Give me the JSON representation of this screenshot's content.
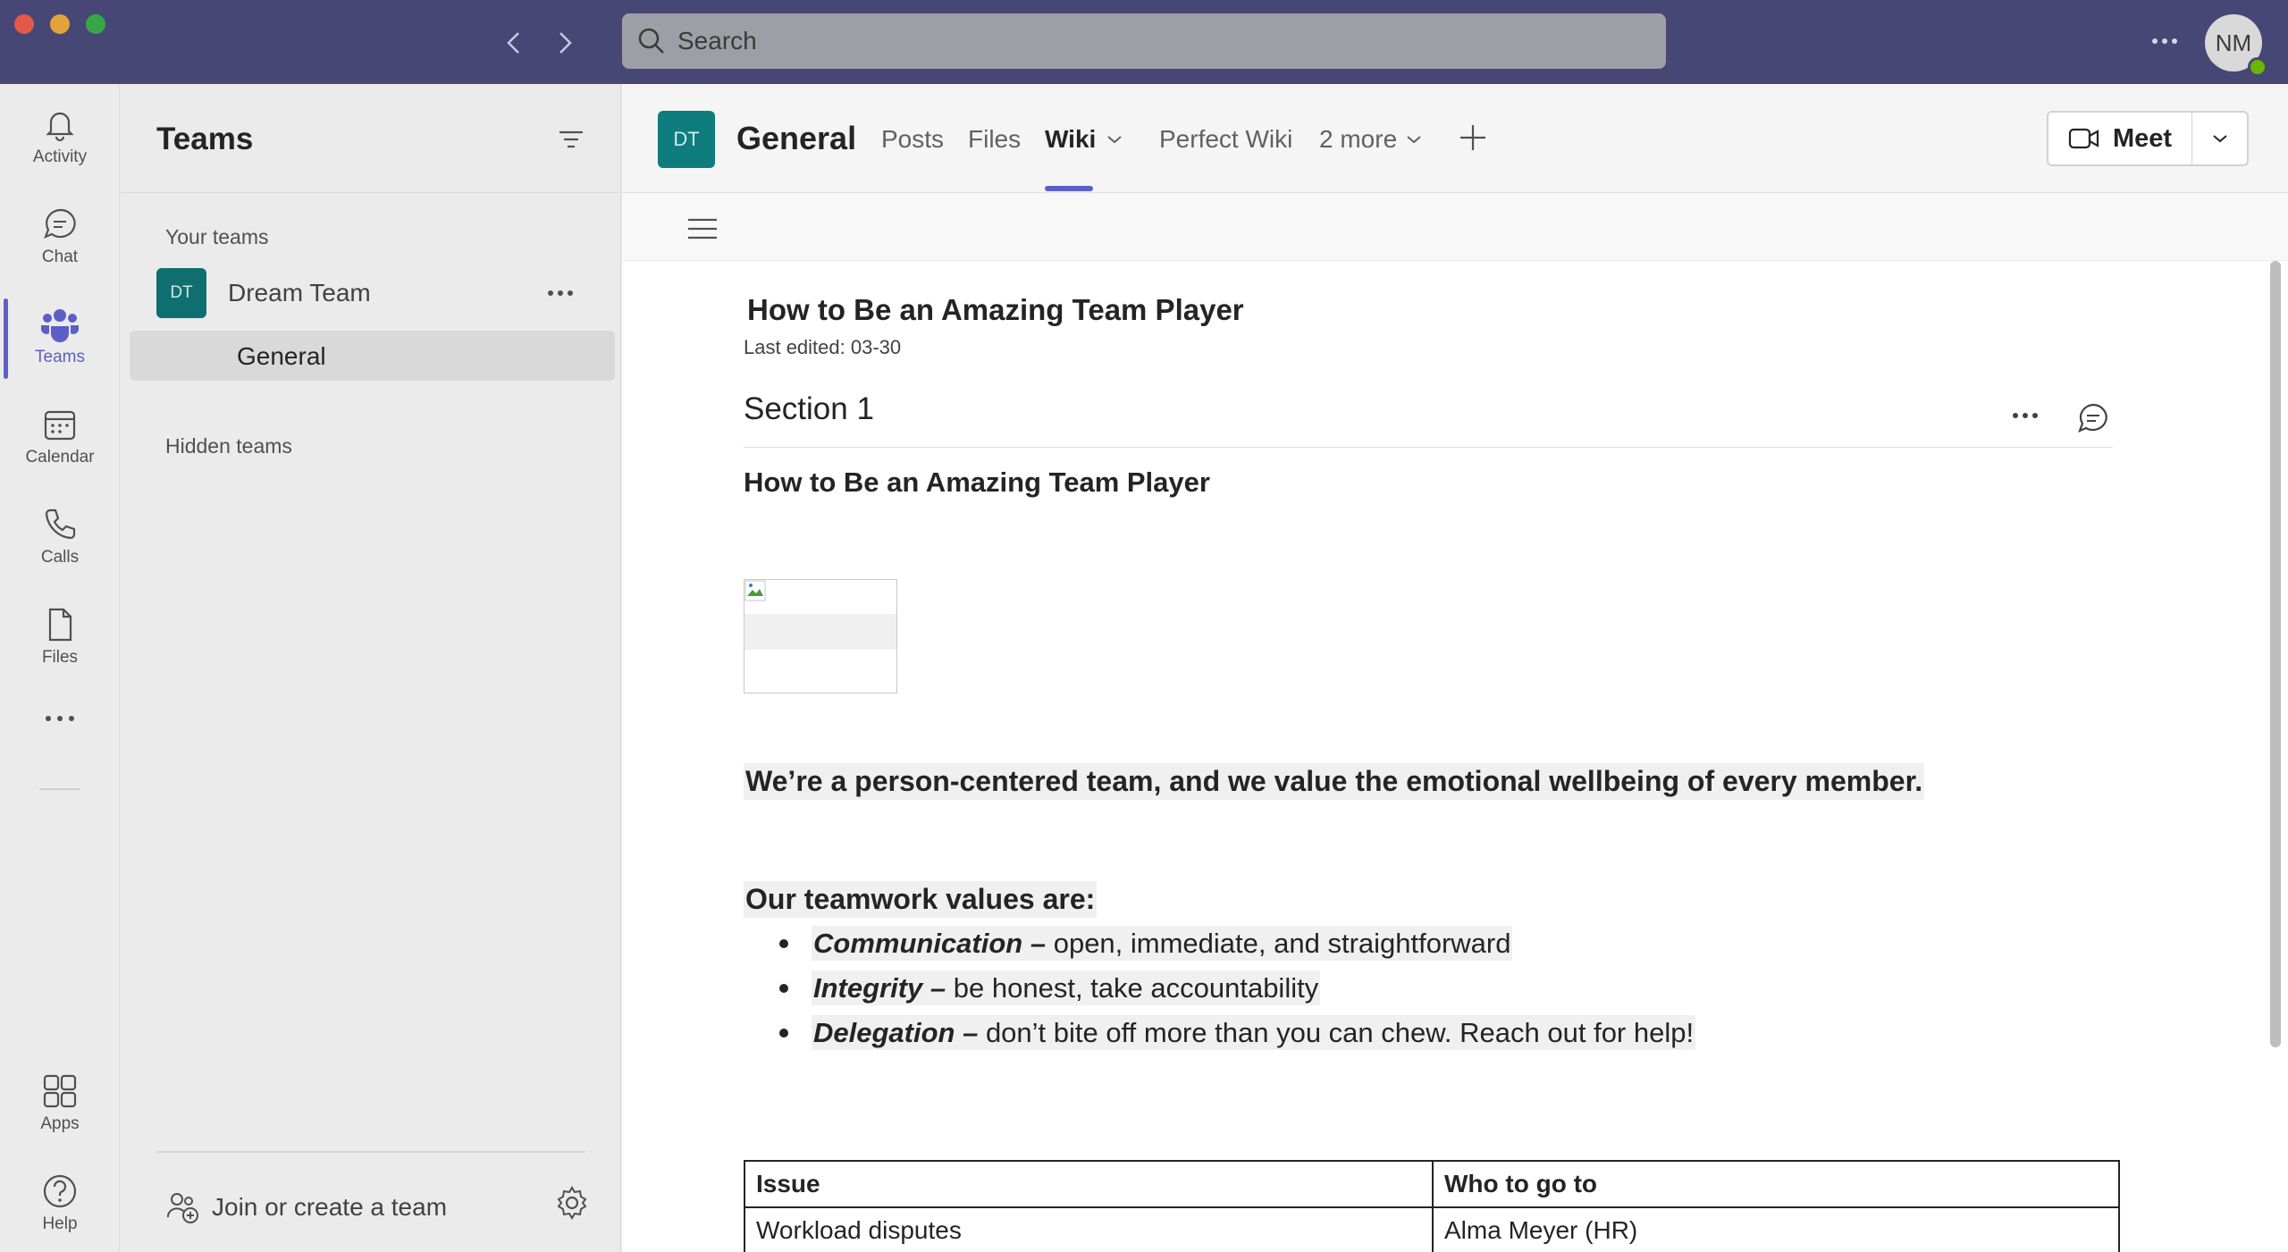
{
  "titlebar": {
    "search_placeholder": "Search",
    "user_initials": "NM",
    "colors": {
      "bar": "#464775",
      "accent": "#5b5fc7",
      "presence": "#6bb700"
    }
  },
  "rail": {
    "items": [
      {
        "label": "Activity",
        "icon": "bell-icon"
      },
      {
        "label": "Chat",
        "icon": "chat-icon"
      },
      {
        "label": "Teams",
        "icon": "teams-icon",
        "active": true
      },
      {
        "label": "Calendar",
        "icon": "calendar-icon"
      },
      {
        "label": "Calls",
        "icon": "phone-icon"
      },
      {
        "label": "Files",
        "icon": "file-icon"
      }
    ],
    "more_icon": "more-icon",
    "apps_label": "Apps",
    "help_label": "Help"
  },
  "teams_panel": {
    "title": "Teams",
    "your_teams_label": "Your teams",
    "team": {
      "initials": "DT",
      "name": "Dream Team"
    },
    "channel": "General",
    "hidden_teams_label": "Hidden teams",
    "join_label": "Join or create a team"
  },
  "channel": {
    "initials": "DT",
    "title": "General",
    "tabs": [
      {
        "label": "Posts"
      },
      {
        "label": "Files"
      },
      {
        "label": "Wiki",
        "active": true
      },
      {
        "label": "Perfect Wiki"
      },
      {
        "label": "2 more"
      }
    ],
    "meet_label": "Meet"
  },
  "wiki": {
    "page_title": "How to Be an Amazing Team Player",
    "last_edited": "Last edited: 03-30",
    "section_title": "Section 1",
    "body_heading": "How to Be an Amazing Team Player",
    "statement": "We’re a person-centered team, and we value the emotional wellbeing of every member.",
    "values_heading": "Our teamwork values are:",
    "values": [
      {
        "term": "Communication –",
        "desc": " open, immediate, and straightforward"
      },
      {
        "term": "Integrity –",
        "desc": " be honest, take accountability"
      },
      {
        "term": "Delegation –",
        "desc": " don’t bite off more than you can chew. Reach out for help!"
      }
    ],
    "table": {
      "headers": [
        "Issue",
        "Who to go to"
      ],
      "rows": [
        [
          "Workload disputes",
          "Alma Meyer (HR)"
        ]
      ]
    }
  }
}
